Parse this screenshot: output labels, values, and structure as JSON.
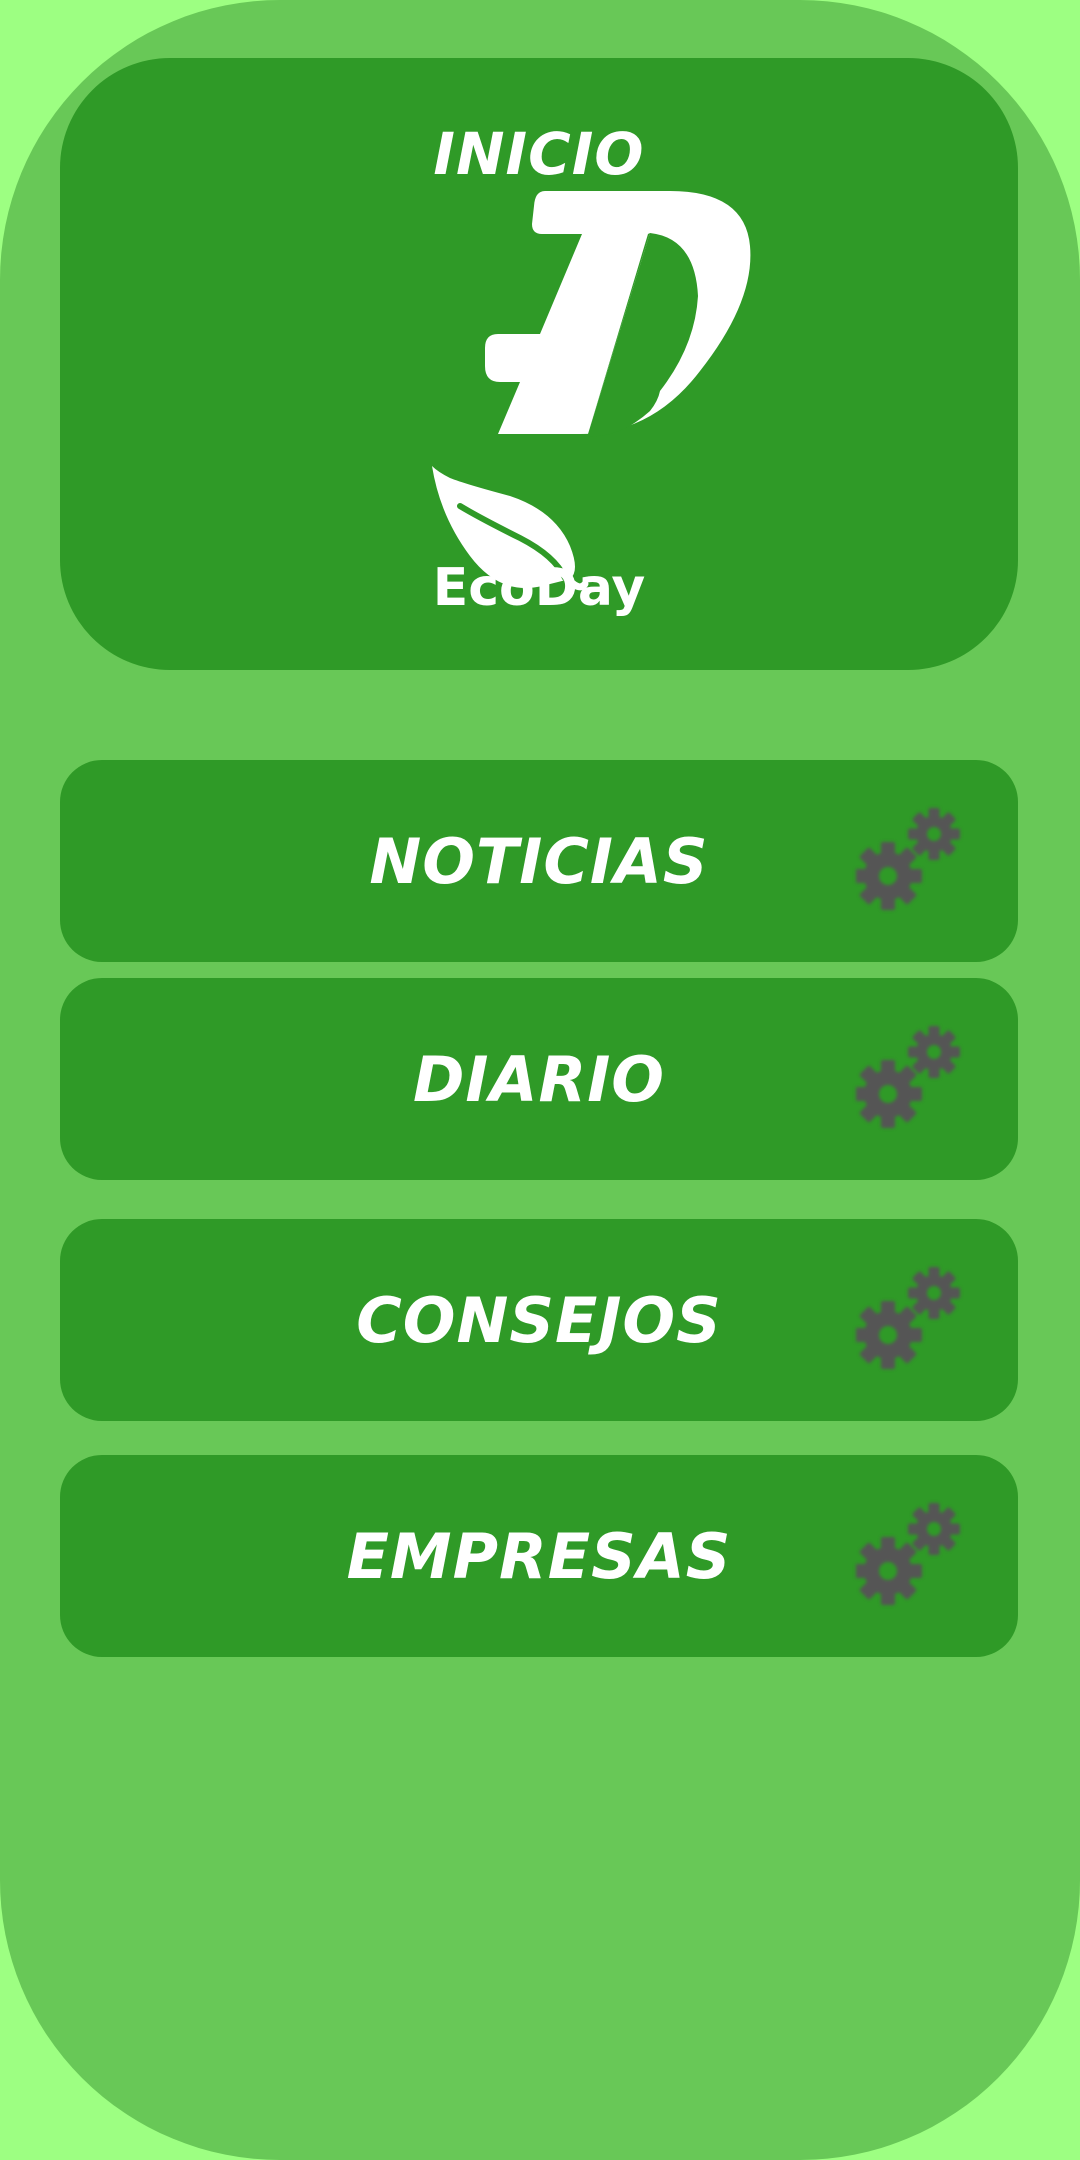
{
  "hero": {
    "title": "INICIO",
    "logo_name": "EcoDay",
    "logo_icon": "ecoday-leaf-d-logo"
  },
  "menu": [
    {
      "label": "NOTICIAS",
      "icon": "gears-icon"
    },
    {
      "label": "DIARIO",
      "icon": "gears-icon"
    },
    {
      "label": "CONSEJOS",
      "icon": "gears-icon"
    },
    {
      "label": "EMPRESAS",
      "icon": "gears-icon"
    }
  ],
  "colors": {
    "outer_background": "#9dff82",
    "frame": "#68c857",
    "card": "#2f9a27",
    "text": "#ffffff",
    "gear": "#555555"
  }
}
